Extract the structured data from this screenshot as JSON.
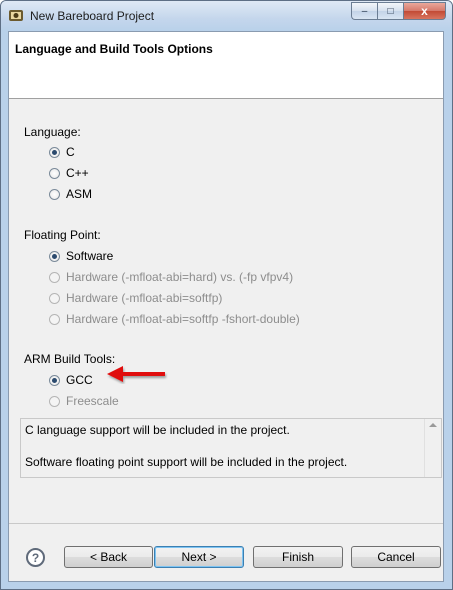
{
  "window": {
    "title": "New Bareboard Project",
    "close_glyph": "x",
    "min_glyph": "–",
    "max_glyph": "□"
  },
  "banner": {
    "title": "Language and Build Tools Options"
  },
  "language": {
    "label": "Language:",
    "options": [
      {
        "label": "C",
        "checked": true,
        "enabled": true
      },
      {
        "label": "C++",
        "checked": false,
        "enabled": true
      },
      {
        "label": "ASM",
        "checked": false,
        "enabled": true
      }
    ]
  },
  "floating_point": {
    "label": "Floating Point:",
    "options": [
      {
        "label": "Software",
        "checked": true,
        "enabled": true
      },
      {
        "label": "Hardware (-mfloat-abi=hard) vs. (-fp vfpv4)",
        "checked": false,
        "enabled": false
      },
      {
        "label": "Hardware (-mfloat-abi=softfp)",
        "checked": false,
        "enabled": false
      },
      {
        "label": "Hardware (-mfloat-abi=softfp -fshort-double)",
        "checked": false,
        "enabled": false
      }
    ]
  },
  "build_tools": {
    "label": "ARM Build Tools:",
    "options": [
      {
        "label": "GCC",
        "checked": true,
        "enabled": true
      },
      {
        "label": "Freescale",
        "checked": false,
        "enabled": false
      }
    ]
  },
  "info": {
    "line1": "C language support will be included in the project.",
    "line2": "Software floating point support will be included in the project."
  },
  "buttons": {
    "help": "?",
    "back": "< Back",
    "next": "Next >",
    "finish": "Finish",
    "cancel": "Cancel"
  },
  "colors": {
    "arrow": "#e01010",
    "title_bar": "#b9d1ea",
    "close_button": "#c24a35"
  }
}
